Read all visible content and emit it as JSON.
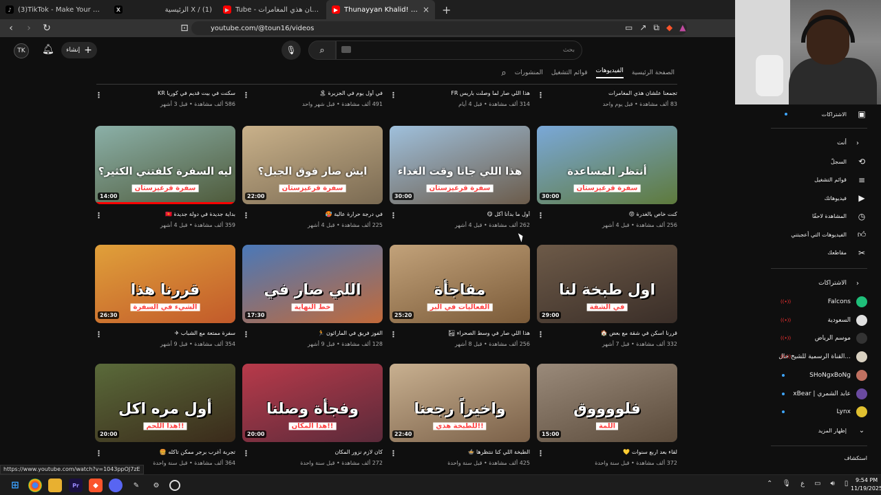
{
  "browser": {
    "tabs": [
      {
        "title": "(3)TikTok - Make Your Day",
        "icon": "tiktok-icon",
        "active": false
      },
      {
        "title": "X / (1) الرئيسية",
        "icon": "x-icon",
        "active": false
      },
      {
        "title": "Tube - تجمعنا علشان هذي المغامرات",
        "icon": "youtube-icon",
        "active": false
      },
      {
        "title": "Thunayyan Khalid! - YouTube",
        "icon": "youtube-icon",
        "active": true
      }
    ],
    "new_tab": "+",
    "url": "youtube.com/@toun16/videos",
    "status_url": "https://www.youtube.com/watch?v=1043ppOJ7zE"
  },
  "header": {
    "logo_text": "TK",
    "create_label": "إنشاء",
    "search_placeholder": "بحث"
  },
  "channel_tabs": [
    "الصفحة الرئيسية",
    "الفيديوهات",
    "قوائم التشغيل",
    "المنشورات"
  ],
  "active_tab": "الفيديوهات",
  "top_row": [
    {
      "title": "تجمعنا علشان هذي المغامرات",
      "meta": "83 ألف مشاهدة • قبل يوم واحد"
    },
    {
      "title": "هذا اللي صار لما وصلت باريس FR",
      "meta": "314 ألف مشاهدة • قبل 4 أيام"
    },
    {
      "title": "في أول يوم في الجزيرة 🏝",
      "meta": "491 ألف مشاهدة • قبل شهر واحد"
    },
    {
      "title": "سكنت في بيت قديم في كوريا KR",
      "meta": "586 ألف مشاهدة • قبل 3 أشهر"
    }
  ],
  "videos": [
    {
      "title": "كنت خاص بالغدرة 😡",
      "meta": "256 ألف مشاهدة • قبل 4 أشهر",
      "duration": "30:00",
      "caption": "أنتظر المساعدة",
      "sub": "سفرة قرغيزستان",
      "colors": [
        "#7aa8d8",
        "#5e7a3c"
      ],
      "progress": 0
    },
    {
      "title": "أول ما بدأنا أكل 😋",
      "meta": "262 ألف مشاهدة • قبل 4 أشهر",
      "duration": "30:00",
      "caption": "هذا اللي جانا وقت الغداء",
      "sub": "سفرة قرغيزستان",
      "colors": [
        "#9fc0dc",
        "#6b5b4a"
      ],
      "progress": 0
    },
    {
      "title": "في درجة حرارة عالية 🥵",
      "meta": "225 ألف مشاهدة • قبل 4 أشهر",
      "duration": "22:00",
      "caption": "ايش صار فوق الجبل؟",
      "sub": "سفرة قرغيزستان",
      "colors": [
        "#c9b18a",
        "#7a6a52"
      ],
      "progress": 0
    },
    {
      "title": "بداية جديدة في دولة جديدة 🇰🇬",
      "meta": "359 ألف مشاهدة • قبل 4 أشهر",
      "duration": "14:00",
      "caption": "ليه السفرة كلفتني الكثير؟",
      "sub": "سفرة قرغيزستان",
      "colors": [
        "#8bb0a8",
        "#4e5a3a"
      ],
      "progress": 1
    },
    {
      "title": "قررنا اسكن في شقة مع بعض 🏠",
      "meta": "332 ألف مشاهدة • قبل 7 أشهر",
      "duration": "29:00",
      "caption": "اول طبخة لنا",
      "sub": "في الشقة",
      "colors": [
        "#6d5a48",
        "#3a2e28"
      ],
      "progress": 0
    },
    {
      "title": "هذا اللي صار في وسط الصحراء 🏜",
      "meta": "256 ألف مشاهدة • قبل 8 أشهر",
      "duration": "25:20",
      "caption": "مفاجأة",
      "sub": "الفعاليات في البر",
      "colors": [
        "#c2a27a",
        "#7a5a38"
      ],
      "progress": 0
    },
    {
      "title": "الفوز فريق في الماراثون 🏃",
      "meta": "128 ألف مشاهدة • قبل 9 أشهر",
      "duration": "17:30",
      "caption": "اللي صار في",
      "sub": "خط النهاية",
      "colors": [
        "#4a78b8",
        "#c26a3a"
      ],
      "progress": 0
    },
    {
      "title": "سفرة ممتعة مع الشباب ✈",
      "meta": "354 ألف مشاهدة • قبل 9 أشهر",
      "duration": "26:30",
      "caption": "قررنا هذا",
      "sub": "الشيء في السفرة",
      "colors": [
        "#e0a03a",
        "#c25a2a"
      ],
      "progress": 0
    },
    {
      "title": "لقاء بعد اربع سنوات 💛",
      "meta": "372 ألف مشاهدة • قبل سنة واحدة",
      "duration": "15:00",
      "caption": "فلووووق",
      "sub": "اللمة",
      "colors": [
        "#9a8a7a",
        "#5a4a3a"
      ],
      "progress": 0
    },
    {
      "title": "الطبخة اللي كنا ننتظرها 🍲",
      "meta": "425 ألف مشاهدة • قبل سنة واحدة",
      "duration": "22:40",
      "caption": "واخيراً رجعنا",
      "sub": "للطبخة هذي!!",
      "colors": [
        "#c8b090",
        "#7a6048"
      ],
      "progress": 0
    },
    {
      "title": "كان لازم نزور المكان",
      "meta": "272 ألف مشاهدة • قبل سنة واحدة",
      "duration": "20:00",
      "caption": "وفجأة وصلنا",
      "sub": "هذا المكان!!",
      "colors": [
        "#b83a4a",
        "#5a2a3a"
      ],
      "progress": 0
    },
    {
      "title": "تجربة أغرب برجر ممكن تاكله 🍔",
      "meta": "364 ألف مشاهدة • قبل سنة واحدة",
      "duration": "20:00",
      "caption": "أول مره اكل",
      "sub": "هذا اللحم!!",
      "colors": [
        "#5a6a3a",
        "#3a2a1a"
      ],
      "progress": 0
    }
  ],
  "sidebar": {
    "subscriptions_top": "الاشتراكات",
    "you_header": "أنت",
    "you_items": [
      {
        "label": "السجلّ",
        "icon": "history-icon"
      },
      {
        "label": "قوائم التشغيل",
        "icon": "playlist-icon"
      },
      {
        "label": "فيديوهاتك",
        "icon": "video-icon"
      },
      {
        "label": "المشاهدة لاحقًا",
        "icon": "clock-icon"
      },
      {
        "label": "الفيديوهات التي أعجبتني",
        "icon": "like-icon"
      },
      {
        "label": "مقاطعك",
        "icon": "scissors-icon"
      }
    ],
    "subs_header": "الاشتراكات",
    "subs": [
      {
        "name": "Falcons",
        "color": "#1fbf7a",
        "live": true
      },
      {
        "name": "السعودية",
        "color": "#e0e0e0",
        "live": true
      },
      {
        "name": "موسم الرياض",
        "color": "#333333",
        "live": true
      },
      {
        "name": "القناة الرسمية للشيخ خال...",
        "color": "#d8d0c0",
        "live": true
      },
      {
        "name": "SHoNgxBoNg",
        "color": "#c07060",
        "live": false
      },
      {
        "name": "xBear | عابد الشمري",
        "color": "#6a4aa0",
        "live": false
      },
      {
        "name": "Lynx",
        "color": "#e0c030",
        "live": false
      }
    ],
    "show_more": "إظهار المزيد",
    "explore": "استكشاف"
  },
  "taskbar": {
    "time": "9:54 PM",
    "date": "11/19/2025",
    "lang": "ع",
    "apps": [
      "windows-icon",
      "chrome-icon",
      "folder-icon",
      "premiere-icon",
      "brave-icon",
      "discord-icon",
      "pen-icon",
      "gear-icon",
      "obs-icon"
    ]
  }
}
